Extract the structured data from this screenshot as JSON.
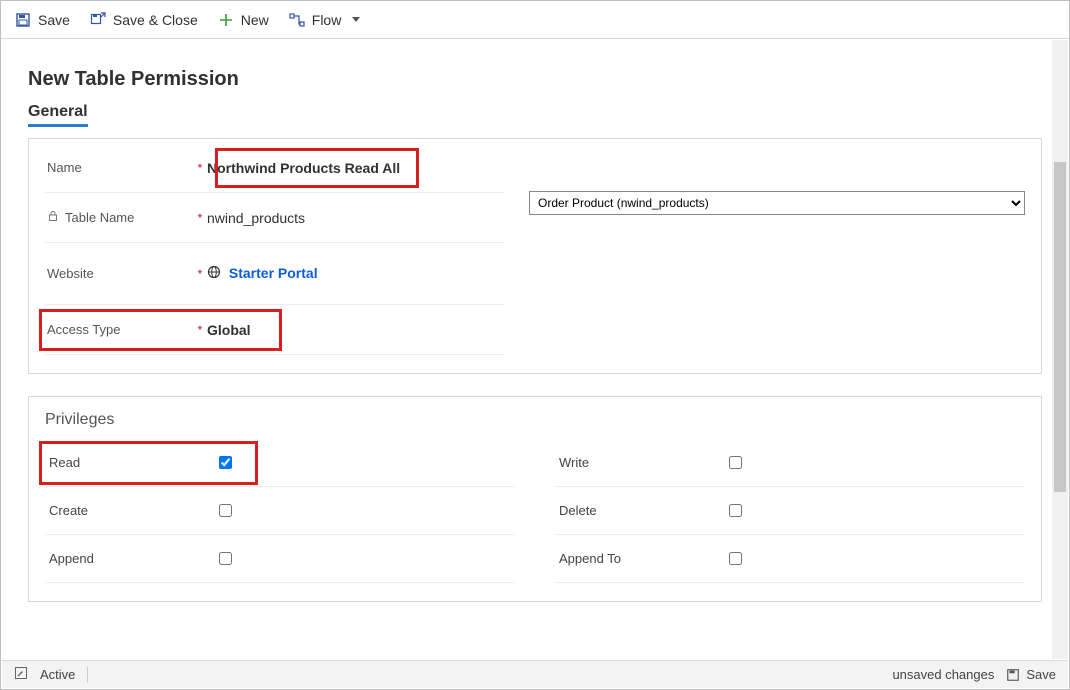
{
  "toolbar": {
    "save": "Save",
    "save_close": "Save & Close",
    "new": "New",
    "flow": "Flow"
  },
  "page": {
    "title": "New Table Permission"
  },
  "tabs": {
    "general": "General"
  },
  "form": {
    "name_label": "Name",
    "name_value": "Northwind Products Read All",
    "table_label": "Table Name",
    "table_value": "nwind_products",
    "website_label": "Website",
    "website_value": "Starter Portal",
    "access_label": "Access Type",
    "access_value": "Global",
    "lookup_value": "Order Product (nwind_products)"
  },
  "privileges": {
    "section": "Privileges",
    "read": "Read",
    "write": "Write",
    "create": "Create",
    "delete": "Delete",
    "append": "Append",
    "append_to": "Append To"
  },
  "status": {
    "active": "Active",
    "unsaved": "unsaved changes",
    "save": "Save"
  }
}
